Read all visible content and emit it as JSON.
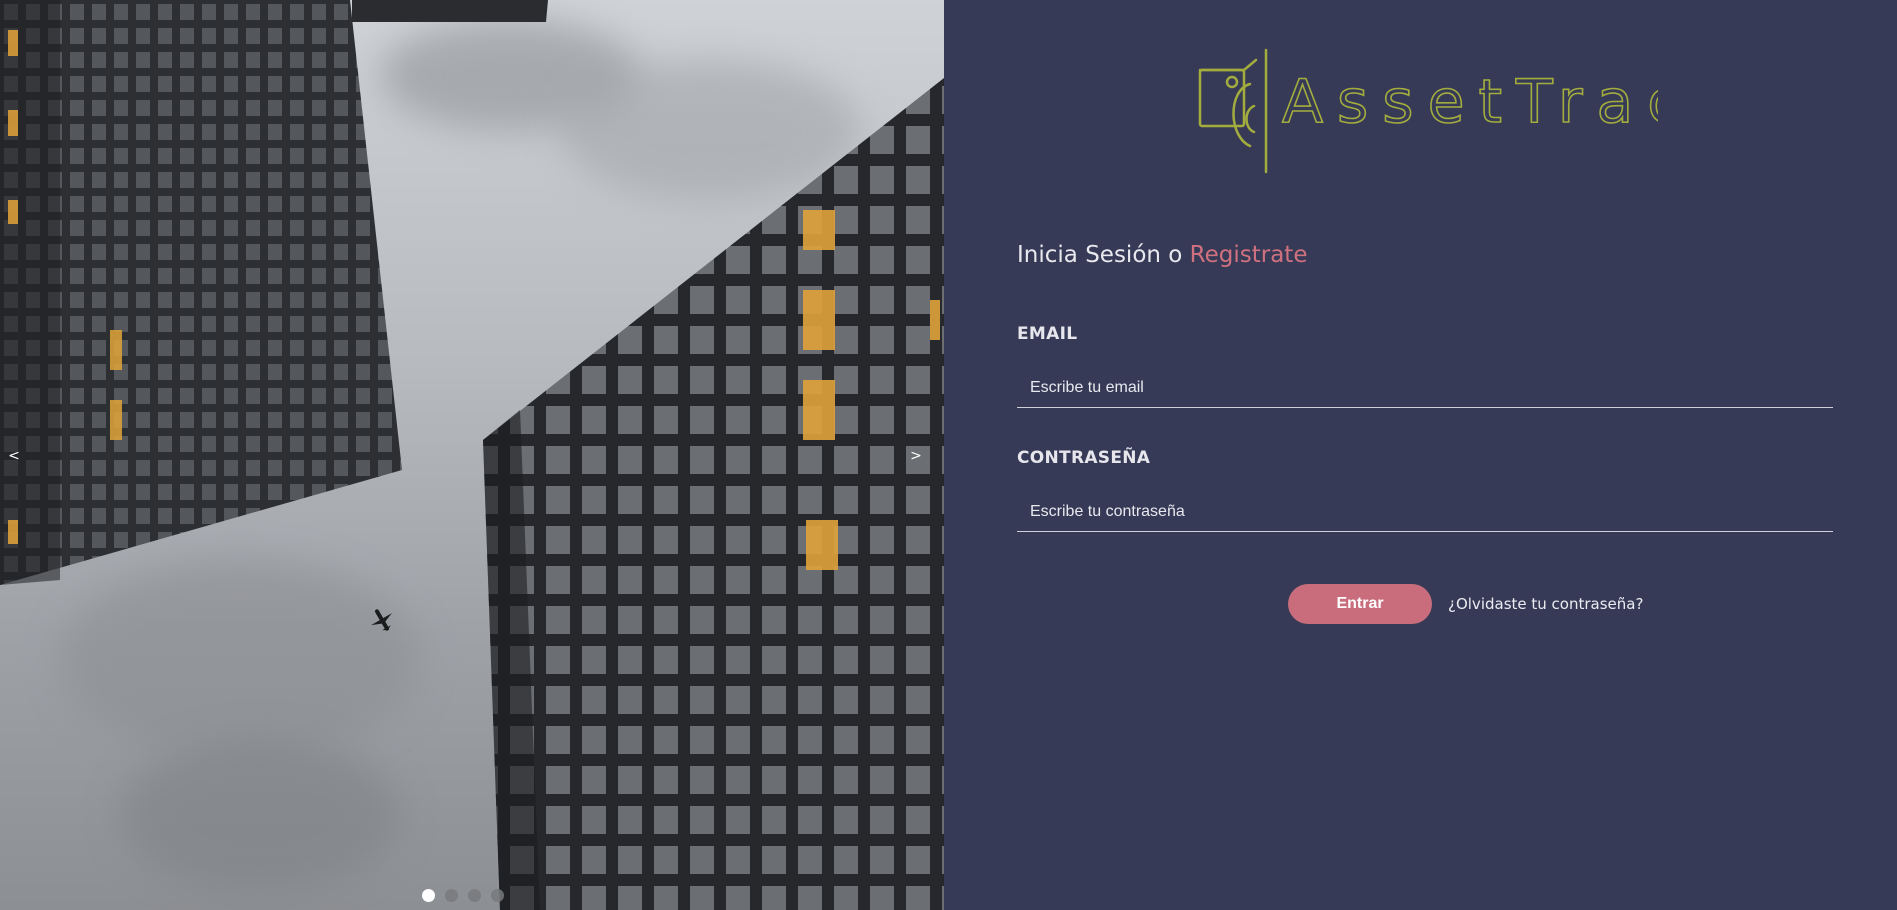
{
  "carousel": {
    "prev_label": "<",
    "next_label": ">",
    "slides_count": 4,
    "active_index": 0
  },
  "brand": {
    "name": "AssetTrack",
    "color": "#a3ad3e"
  },
  "login": {
    "title_prefix": "Inicia Sesión o ",
    "register_link": "Registrate",
    "email_label": "EMAIL",
    "email_placeholder": "Escribe tu email",
    "password_label": "CONTRASEÑA",
    "password_placeholder": "Escribe tu contraseña",
    "submit_label": "Entrar",
    "forgot_link": "¿Olvidaste tu contraseña?"
  },
  "colors": {
    "panel_bg": "#363a56",
    "accent": "#c96d7c"
  }
}
